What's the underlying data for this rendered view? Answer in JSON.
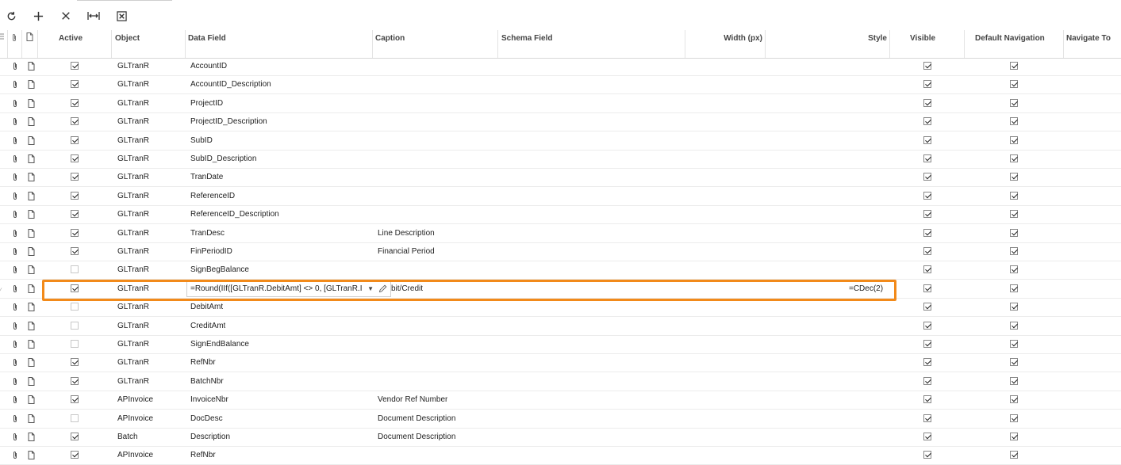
{
  "toolbar": {
    "buttons": [
      {
        "name": "refresh-icon"
      },
      {
        "name": "add-icon"
      },
      {
        "name": "delete-icon"
      },
      {
        "name": "fit-columns-icon"
      },
      {
        "name": "export-excel-icon"
      }
    ]
  },
  "columns": {
    "active": "Active",
    "object": "Object",
    "data_field": "Data Field",
    "caption": "Caption",
    "schema_field": "Schema Field",
    "width": "Width (px)",
    "style": "Style",
    "visible": "Visible",
    "default_navigation": "Default Navigation",
    "navigate_to": "Navigate To"
  },
  "rows": [
    {
      "active": true,
      "object": "GLTranR",
      "data_field": "AccountID",
      "caption": "",
      "style": "",
      "visible": true,
      "default_nav": true
    },
    {
      "active": true,
      "object": "GLTranR",
      "data_field": "AccountID_Description",
      "caption": "",
      "style": "",
      "visible": true,
      "default_nav": true
    },
    {
      "active": true,
      "object": "GLTranR",
      "data_field": "ProjectID",
      "caption": "",
      "style": "",
      "visible": true,
      "default_nav": true
    },
    {
      "active": true,
      "object": "GLTranR",
      "data_field": "ProjectID_Description",
      "caption": "",
      "style": "",
      "visible": true,
      "default_nav": true
    },
    {
      "active": true,
      "object": "GLTranR",
      "data_field": "SubID",
      "caption": "",
      "style": "",
      "visible": true,
      "default_nav": true
    },
    {
      "active": true,
      "object": "GLTranR",
      "data_field": "SubID_Description",
      "caption": "",
      "style": "",
      "visible": true,
      "default_nav": true
    },
    {
      "active": true,
      "object": "GLTranR",
      "data_field": "TranDate",
      "caption": "",
      "style": "",
      "visible": true,
      "default_nav": true
    },
    {
      "active": true,
      "object": "GLTranR",
      "data_field": "ReferenceID",
      "caption": "",
      "style": "",
      "visible": true,
      "default_nav": true
    },
    {
      "active": true,
      "object": "GLTranR",
      "data_field": "ReferenceID_Description",
      "caption": "",
      "style": "",
      "visible": true,
      "default_nav": true
    },
    {
      "active": true,
      "object": "GLTranR",
      "data_field": "TranDesc",
      "caption": "Line Description",
      "style": "",
      "visible": true,
      "default_nav": true
    },
    {
      "active": true,
      "object": "GLTranR",
      "data_field": "FinPeriodID",
      "caption": "Financial Period",
      "style": "",
      "visible": true,
      "default_nav": true
    },
    {
      "active": false,
      "object": "GLTranR",
      "data_field": "SignBegBalance",
      "caption": "",
      "style": "",
      "visible": true,
      "default_nav": true
    },
    {
      "active": true,
      "object": "GLTranR",
      "data_field": "=Round(IIf([GLTranR.DebitAmt] <> 0, [GLTranR.I",
      "caption": "bit/Credit",
      "style": "=CDec(2)",
      "visible": true,
      "default_nav": true,
      "editing": true
    },
    {
      "active": false,
      "object": "GLTranR",
      "data_field": "DebitAmt",
      "caption": "",
      "style": "",
      "visible": true,
      "default_nav": true
    },
    {
      "active": false,
      "object": "GLTranR",
      "data_field": "CreditAmt",
      "caption": "",
      "style": "",
      "visible": true,
      "default_nav": true
    },
    {
      "active": false,
      "object": "GLTranR",
      "data_field": "SignEndBalance",
      "caption": "",
      "style": "",
      "visible": true,
      "default_nav": true
    },
    {
      "active": true,
      "object": "GLTranR",
      "data_field": "RefNbr",
      "caption": "",
      "style": "",
      "visible": true,
      "default_nav": true
    },
    {
      "active": true,
      "object": "GLTranR",
      "data_field": "BatchNbr",
      "caption": "",
      "style": "",
      "visible": true,
      "default_nav": true
    },
    {
      "active": true,
      "object": "APInvoice",
      "data_field": "InvoiceNbr",
      "caption": "Vendor Ref Number",
      "style": "",
      "visible": true,
      "default_nav": true
    },
    {
      "active": false,
      "object": "APInvoice",
      "data_field": "DocDesc",
      "caption": "Document Description",
      "style": "",
      "visible": true,
      "default_nav": true
    },
    {
      "active": true,
      "object": "Batch",
      "data_field": "Description",
      "caption": "Document Description",
      "style": "",
      "visible": true,
      "default_nav": true
    },
    {
      "active": true,
      "object": "APInvoice",
      "data_field": "RefNbr",
      "caption": "",
      "style": "",
      "visible": true,
      "default_nav": true
    }
  ]
}
